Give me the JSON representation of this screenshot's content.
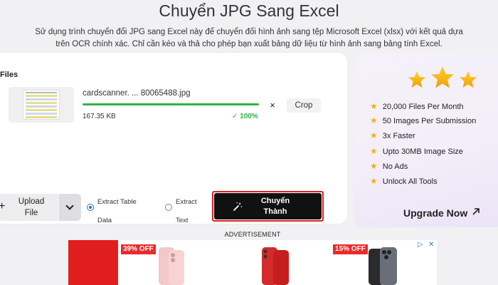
{
  "header": {
    "title": "Chuyển JPG Sang Excel",
    "description": "Sử dụng trình chuyển đổi JPG sang Excel này để chuyển đổi hình ảnh sang tệp Microsoft Excel (xlsx) với kết quả dựa trên OCR chính xác. Chỉ cần kéo và thả cho phép bạn xuất bảng dữ liệu từ hình ảnh sang bảng tính Excel."
  },
  "files": {
    "label": "Files",
    "item": {
      "name": "cardscanner. ... 80065488.jpg",
      "size": "167.35 KB",
      "progress_text": "✓ 100%",
      "progress": 1.0,
      "remove_symbol": "×",
      "crop_label": "Crop"
    }
  },
  "controls": {
    "upload_label": "Upload File",
    "upload_plus": "+",
    "options": [
      {
        "label": "Extract Table Data",
        "checked": true
      },
      {
        "label": "Extract Text",
        "checked": false
      }
    ],
    "convert_label": "Chuyển Thành"
  },
  "sidebar": {
    "features": [
      "20,000 Files Per Month",
      "50 Images Per Submission",
      "3x Faster",
      "Upto 30MB Image Size",
      "No Ads",
      "Unlock All Tools"
    ],
    "upgrade_label": "Upgrade Now",
    "star_color": "#f5b301"
  },
  "ad": {
    "label": "ADVERTISEMENT",
    "badges": [
      "39% OFF",
      "15% OFF"
    ],
    "accent": "#e01e1e"
  },
  "colors": {
    "progress": "#2fb344",
    "highlight_outline": "#e02020"
  }
}
